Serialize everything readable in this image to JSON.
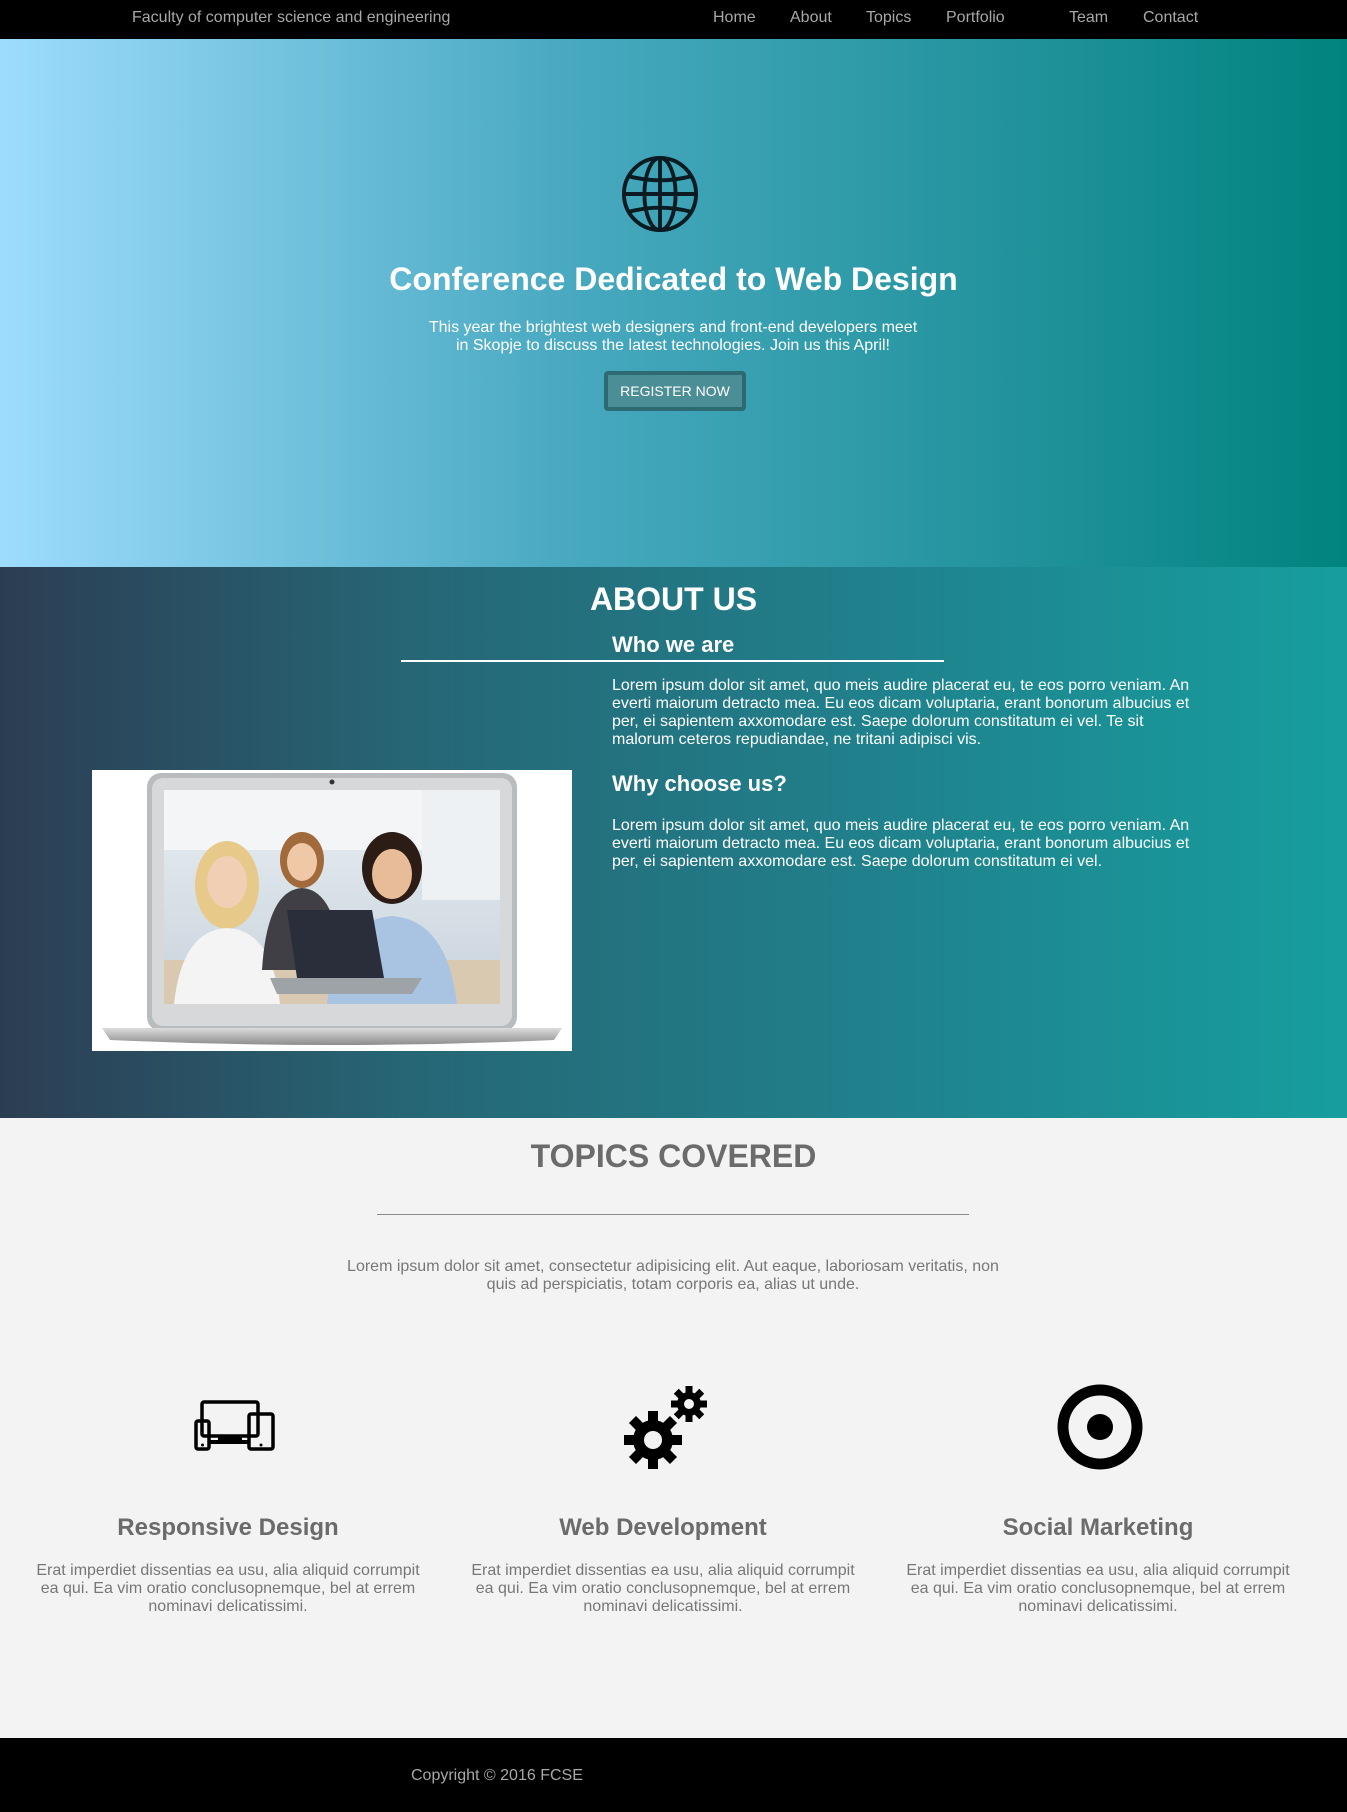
{
  "nav": {
    "brand": "Faculty of computer science and engineering",
    "links": [
      "Home",
      "About",
      "Topics",
      "Portfolio",
      "Team",
      "Contact"
    ]
  },
  "hero": {
    "icon": "globe-icon",
    "title": "Conference Dedicated to Web Design",
    "subtitle": "This year the brightest web designers and front-end developers meet in Skopje to discuss the latest technologies. Join us this April!",
    "button_label": "REGISTER NOW"
  },
  "about": {
    "title": "ABOUT US",
    "image": "team-laptop-photo",
    "who_heading": "Who we are",
    "who_text": "Lorem ipsum dolor sit amet, quo meis audire placerat eu, te eos porro veniam. An everti maiorum detracto mea. Eu eos dicam voluptaria, erant bonorum albucius et per, ei sapientem axxomodare est. Saepe dolorum constitatum ei vel. Te sit malorum ceteros repudiandae, ne tritani adipisci vis.",
    "why_heading": "Why choose us?",
    "why_text": "Lorem ipsum dolor sit amet, quo meis audire placerat eu, te eos porro veniam. An everti maiorum detracto mea. Eu eos dicam voluptaria, erant bonorum albucius et per, ei sapientem axxomodare est. Saepe dolorum constitatum ei vel."
  },
  "topics": {
    "title": "TOPICS COVERED",
    "intro": "Lorem ipsum dolor sit amet, consectetur adipisicing elit. Aut eaque, laboriosam veritatis, non quis ad perspiciatis, totam corporis ea, alias ut unde.",
    "items": [
      {
        "icon": "devices-icon",
        "title": "Responsive Design",
        "text": "Erat imperdiet dissentias ea usu, alia aliquid corrumpit ea qui. Ea vim oratio conclusopnemque, bel at errem nominavi delicatissimi."
      },
      {
        "icon": "gears-icon",
        "title": "Web Development",
        "text": "Erat imperdiet dissentias ea usu, alia aliquid corrumpit ea qui. Ea vim oratio conclusopnemque, bel at errem nominavi delicatissimi."
      },
      {
        "icon": "target-icon",
        "title": "Social Marketing",
        "text": "Erat imperdiet dissentias ea usu, alia aliquid corrumpit ea qui. Ea vim oratio conclusopnemque, bel at errem nominavi delicatissimi."
      }
    ]
  },
  "footer": {
    "copyright": "Copyright © 2016 FCSE"
  },
  "colors": {
    "nav_bg": "#000000",
    "nav_text": "#a8a8a8",
    "hero_gradient_start": "#9edcfd",
    "hero_gradient_end": "#00837f",
    "about_gradient_start": "#2c3d53",
    "about_gradient_end": "#169e9e",
    "button_bg": "#4b8e95",
    "topics_bg": "#f3f3f3",
    "topics_heading": "#6b6b6b"
  }
}
